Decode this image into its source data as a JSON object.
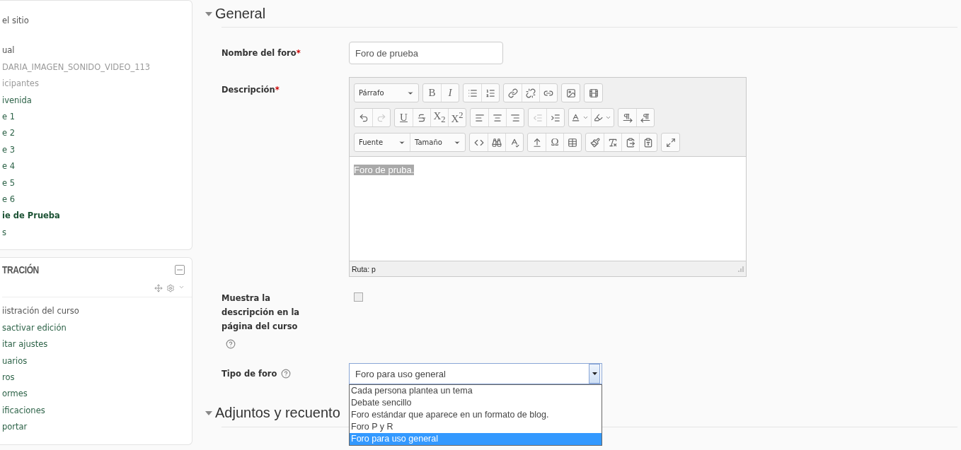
{
  "sidebar": {
    "navigation": {
      "items": [
        {
          "label": "el sitio",
          "kind": "plain",
          "selected": false
        },
        {
          "label": "ual",
          "kind": "plain",
          "selected": false
        },
        {
          "label": "DARIA_IMAGEN_SONIDO_VIDEO_113",
          "kind": "muted",
          "selected": false
        },
        {
          "label": "icipantes",
          "kind": "muted",
          "selected": false
        },
        {
          "label": "ivenida",
          "kind": "link",
          "selected": false
        },
        {
          "label": "e 1",
          "kind": "link",
          "selected": false
        },
        {
          "label": "e 2",
          "kind": "link",
          "selected": false
        },
        {
          "label": "e 3",
          "kind": "link",
          "selected": false
        },
        {
          "label": "e 4",
          "kind": "link",
          "selected": false
        },
        {
          "label": "e 5",
          "kind": "link",
          "selected": false
        },
        {
          "label": "e 6",
          "kind": "link",
          "selected": false
        },
        {
          "label": "ie de Prueba",
          "kind": "link",
          "selected": true
        },
        {
          "label": "s",
          "kind": "link",
          "selected": false
        }
      ]
    },
    "administration": {
      "title": "TRACIÓN",
      "items": [
        {
          "label": "iistración del curso",
          "kind": "plain"
        },
        {
          "label": "sactivar edición",
          "kind": "link"
        },
        {
          "label": "itar ajustes",
          "kind": "link"
        },
        {
          "label": "uarios",
          "kind": "link"
        },
        {
          "label": "ros",
          "kind": "link"
        },
        {
          "label": "ormes",
          "kind": "link"
        },
        {
          "label": "ificaciones",
          "kind": "link"
        },
        {
          "label": "portar",
          "kind": "link"
        }
      ]
    }
  },
  "form": {
    "sections": [
      {
        "title": "General",
        "expanded": true
      },
      {
        "title": "Adjuntos y recuento",
        "expanded": true
      }
    ],
    "forum_name": {
      "label": "Nombre del foro",
      "required_mark": "*",
      "value": "Foro de prueba"
    },
    "description": {
      "label": "Descripción",
      "required_mark": "*",
      "toolbar": [
        [
          [
            {
              "kind": "dropdown",
              "label": "Párrafo"
            }
          ],
          [
            {
              "kind": "glyph",
              "glyph": "B"
            },
            {
              "kind": "glyph",
              "glyph": "I"
            }
          ],
          [
            {
              "kind": "icon"
            },
            {
              "kind": "icon"
            }
          ],
          [
            {
              "kind": "icon"
            },
            {
              "kind": "icon"
            },
            {
              "kind": "icon"
            }
          ],
          [
            {
              "kind": "icon"
            }
          ],
          [
            {
              "kind": "icon"
            }
          ]
        ],
        [
          [
            {
              "kind": "icon"
            },
            {
              "kind": "icon",
              "disabled": true
            }
          ],
          [
            {
              "kind": "glyph",
              "glyph": "U"
            },
            {
              "kind": "icon"
            },
            {
              "kind": "glyph",
              "glyph": "X$_{2}$"
            },
            {
              "kind": "glyph",
              "glyph": "X$^{2}$"
            }
          ],
          [
            {
              "kind": "icon"
            },
            {
              "kind": "icon"
            },
            {
              "kind": "icon"
            }
          ],
          [
            {
              "kind": "icon",
              "disabled": true
            },
            {
              "kind": "icon"
            }
          ],
          [
            {
              "kind": "menu"
            },
            {
              "kind": "menu"
            }
          ],
          [
            {
              "kind": "icon"
            },
            {
              "kind": "icon"
            }
          ]
        ],
        [
          [
            {
              "kind": "dropdown",
              "label": "Fuente"
            },
            {
              "kind": "dropdown",
              "label": "Tamaño"
            }
          ],
          [
            {
              "kind": "icon"
            },
            {
              "kind": "icon"
            },
            {
              "kind": "icon"
            }
          ],
          [
            {
              "kind": "icon"
            },
            {
              "kind": "glyph",
              "glyph": "Ω"
            },
            {
              "kind": "icon"
            }
          ],
          [
            {
              "kind": "icon"
            },
            {
              "kind": "icon"
            },
            {
              "kind": "icon"
            },
            {
              "kind": "icon"
            }
          ],
          [
            {
              "kind": "icon"
            }
          ]
        ]
      ],
      "content": {
        "text": "Foro de pruba.",
        "selected": true
      },
      "path": "Ruta: p"
    },
    "show_description": {
      "label": "Muestra la descripción en la página del curso",
      "checked": false
    },
    "forum_type": {
      "label": "Tipo de foro",
      "value": "Foro para uso general",
      "expanded": true,
      "options": [
        {
          "label": "Cada persona plantea un tema",
          "selected": false
        },
        {
          "label": "Debate sencillo",
          "selected": false
        },
        {
          "label": "Foro estándar que aparece en un formato de blog.",
          "selected": false
        },
        {
          "label": "Foro P y R",
          "selected": false
        },
        {
          "label": "Foro para uso general",
          "selected": true
        }
      ]
    }
  }
}
